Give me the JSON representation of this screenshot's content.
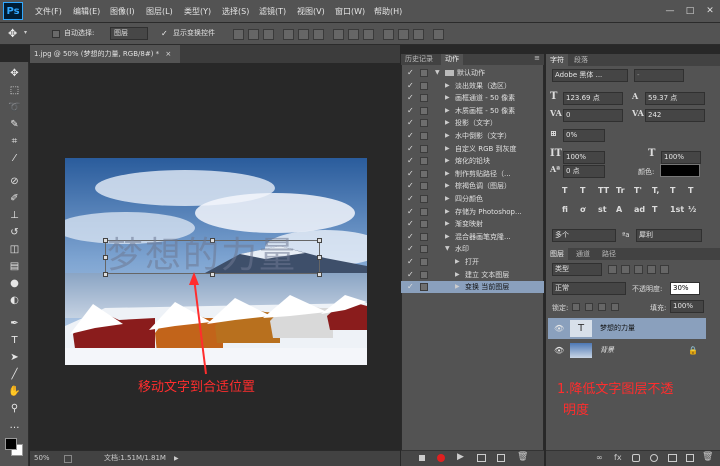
{
  "app": {
    "logo": "Ps"
  },
  "menu": [
    "文件(F)",
    "编辑(E)",
    "图像(I)",
    "图层(L)",
    "类型(Y)",
    "选择(S)",
    "滤镜(T)",
    "视图(V)",
    "窗口(W)",
    "帮助(H)"
  ],
  "window_controls": [
    "—",
    "□",
    "✕"
  ],
  "options_bar": {
    "auto_select_label": "自动选择:",
    "auto_select_value": "图层",
    "show_transform_label": "显示变换控件"
  },
  "document": {
    "tab_title": "1.jpg @ 50% (梦想的力量, RGB/8#) *",
    "close": "×",
    "zoom": "50%",
    "doc_info": "文档:1.51M/1.81M",
    "overlay_text": "梦想的力量"
  },
  "actions_panel": {
    "tabs": [
      "历史记录",
      "动作"
    ],
    "rows": [
      {
        "label": "默认动作",
        "level": 0,
        "open": true,
        "folder": true
      },
      {
        "label": "淡出效果（选区）",
        "level": 1
      },
      {
        "label": "画框通道 - 50 像素",
        "level": 1
      },
      {
        "label": "木质画框 - 50 像素",
        "level": 1
      },
      {
        "label": "投影（文字）",
        "level": 1
      },
      {
        "label": "水中倒影（文字）",
        "level": 1
      },
      {
        "label": "自定义 RGB 到灰度",
        "level": 1
      },
      {
        "label": "熔化的铅块",
        "level": 1
      },
      {
        "label": "制作剪贴路径（...",
        "level": 1
      },
      {
        "label": "棕褐色调（图层）",
        "level": 1
      },
      {
        "label": "四分颜色",
        "level": 1
      },
      {
        "label": "存储为 Photoshop...",
        "level": 1
      },
      {
        "label": "渐变映射",
        "level": 1
      },
      {
        "label": "混合器画笔克隆...",
        "level": 1
      },
      {
        "label": "水印",
        "level": 1,
        "open": true
      },
      {
        "label": "打开",
        "level": 2
      },
      {
        "label": "建立 文本图层",
        "level": 2
      },
      {
        "label": "变换 当前图层",
        "level": 2,
        "selected": true
      }
    ]
  },
  "character_panel": {
    "tabs": [
      "字符",
      "段落"
    ],
    "font_family": "Adobe 黑体 ...",
    "font_style": "-",
    "font_size": "123.69 点",
    "leading": "59.37 点",
    "kerning": "0",
    "tracking": "242",
    "scale_pct": "0%",
    "vertical_scale": "100%",
    "horizontal_scale": "100%",
    "baseline": "0 点",
    "color_label": "颜色:",
    "glyphs": [
      "T",
      "T",
      "TT",
      "Tr",
      "T'",
      "T,",
      "T",
      "T"
    ],
    "glyphs2": [
      "fi",
      "ơ",
      "st",
      "A",
      "ad",
      "T",
      "1st",
      "½"
    ],
    "language": "多个",
    "antialias_prefix": "ªa",
    "antialias": "犀利"
  },
  "layers_panel": {
    "tabs": [
      "图层",
      "通道",
      "路径"
    ],
    "filter": "类型",
    "blend_mode": "正常",
    "opacity_label": "不透明度:",
    "opacity": "30%",
    "lock_label": "锁定:",
    "fill_label": "填充:",
    "fill": "100%",
    "layers": [
      {
        "name": "梦想的力量",
        "type": "text",
        "selected": true
      },
      {
        "name": "背景",
        "type": "image",
        "locked": true
      }
    ]
  },
  "annotations": {
    "move_text": "移动文字到合适位置",
    "opacity_note_1": "1.降低文字图层不透",
    "opacity_note_2": "明度"
  },
  "colors": {
    "accent": "#31a8ff",
    "annotation": "#ff2d2d",
    "panel": "#535353",
    "dark": "#282828"
  }
}
